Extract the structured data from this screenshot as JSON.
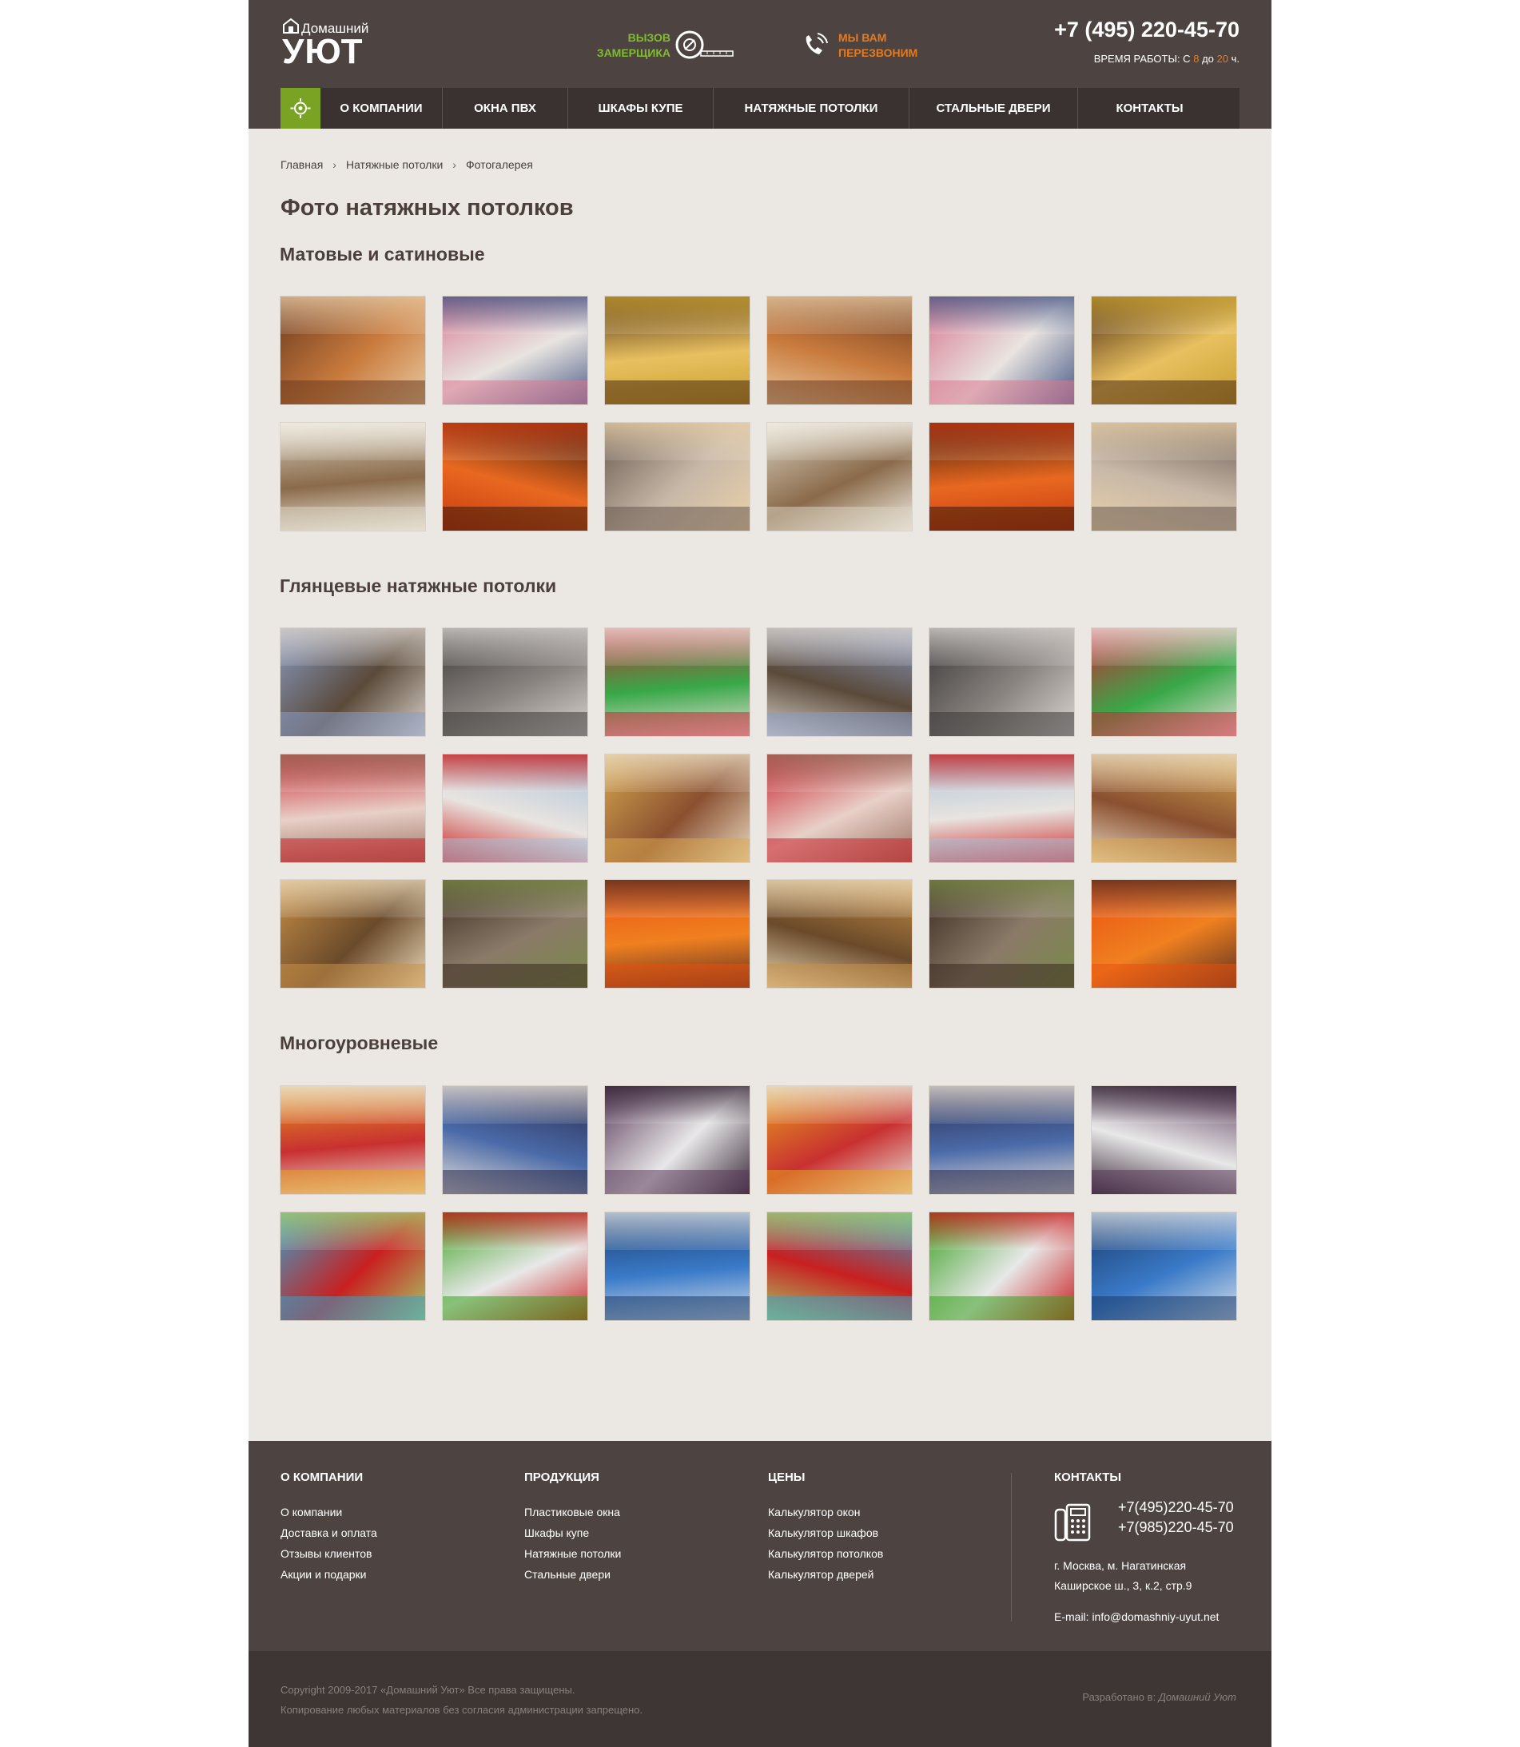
{
  "header": {
    "logo_small": "Домашний",
    "logo_big": "УЮТ",
    "measure_line1": "Вызов",
    "measure_line2": "замерщика",
    "callback_line1": "Мы вам",
    "callback_line2": "перезвоним",
    "phone": "+7 (495) 220-45-70",
    "hours_prefix": "Время работы: с",
    "hours_from": "8",
    "hours_mid": "до",
    "hours_to": "20",
    "hours_suffix": "ч."
  },
  "nav": {
    "items": [
      "О компании",
      "Окна ПВХ",
      "Шкафы купе",
      "Натяжные потолки",
      "Стальные двери",
      "Контакты"
    ]
  },
  "breadcrumb": [
    "Главная",
    "Натяжные потолки",
    "Фотогалерея"
  ],
  "page_title": "Фото натяжных потолков",
  "sections": [
    {
      "title": "Матовые и сатиновые"
    },
    {
      "title": "Глянцевые натяжные потолки"
    },
    {
      "title": "Многоуровневые"
    }
  ],
  "footer": {
    "col1": {
      "title": "О компании",
      "links": [
        "О компании",
        "Доставка и оплата",
        "Отзывы клиентов",
        "Акции и подарки"
      ]
    },
    "col2": {
      "title": "Продукция",
      "links": [
        "Пластиковые окна",
        "Шкафы купе",
        "Натяжные потолки",
        "Стальные двери"
      ]
    },
    "col3": {
      "title": "Цены",
      "links": [
        "Калькулятор окон",
        "Калькулятор шкафов",
        "Калькулятор потолков",
        "Калькулятор дверей"
      ]
    },
    "contacts": {
      "title": "Контакты",
      "phone1": "+7(495)220-45-70",
      "phone2": "+7(985)220-45-70",
      "addr1": "г. Москва, м. Нагатинская",
      "addr2": "Каширское ш., 3, к.2, стр.9",
      "email": "E-mail: info@domashniy-uyut.net"
    },
    "copyright1": "Copyright 2009-2017 «Домашний Уют» Все права защищены.",
    "copyright2": "Копирование любых материалов без согласия администрации запрещено.",
    "dev_prefix": "Разработано в:",
    "dev_name": "Домашний Уют"
  },
  "colors": {
    "header_bg": "#4d4441",
    "page_bg": "#ebe8e4",
    "accent_green": "#7aa324",
    "accent_orange": "#e57a1e"
  }
}
